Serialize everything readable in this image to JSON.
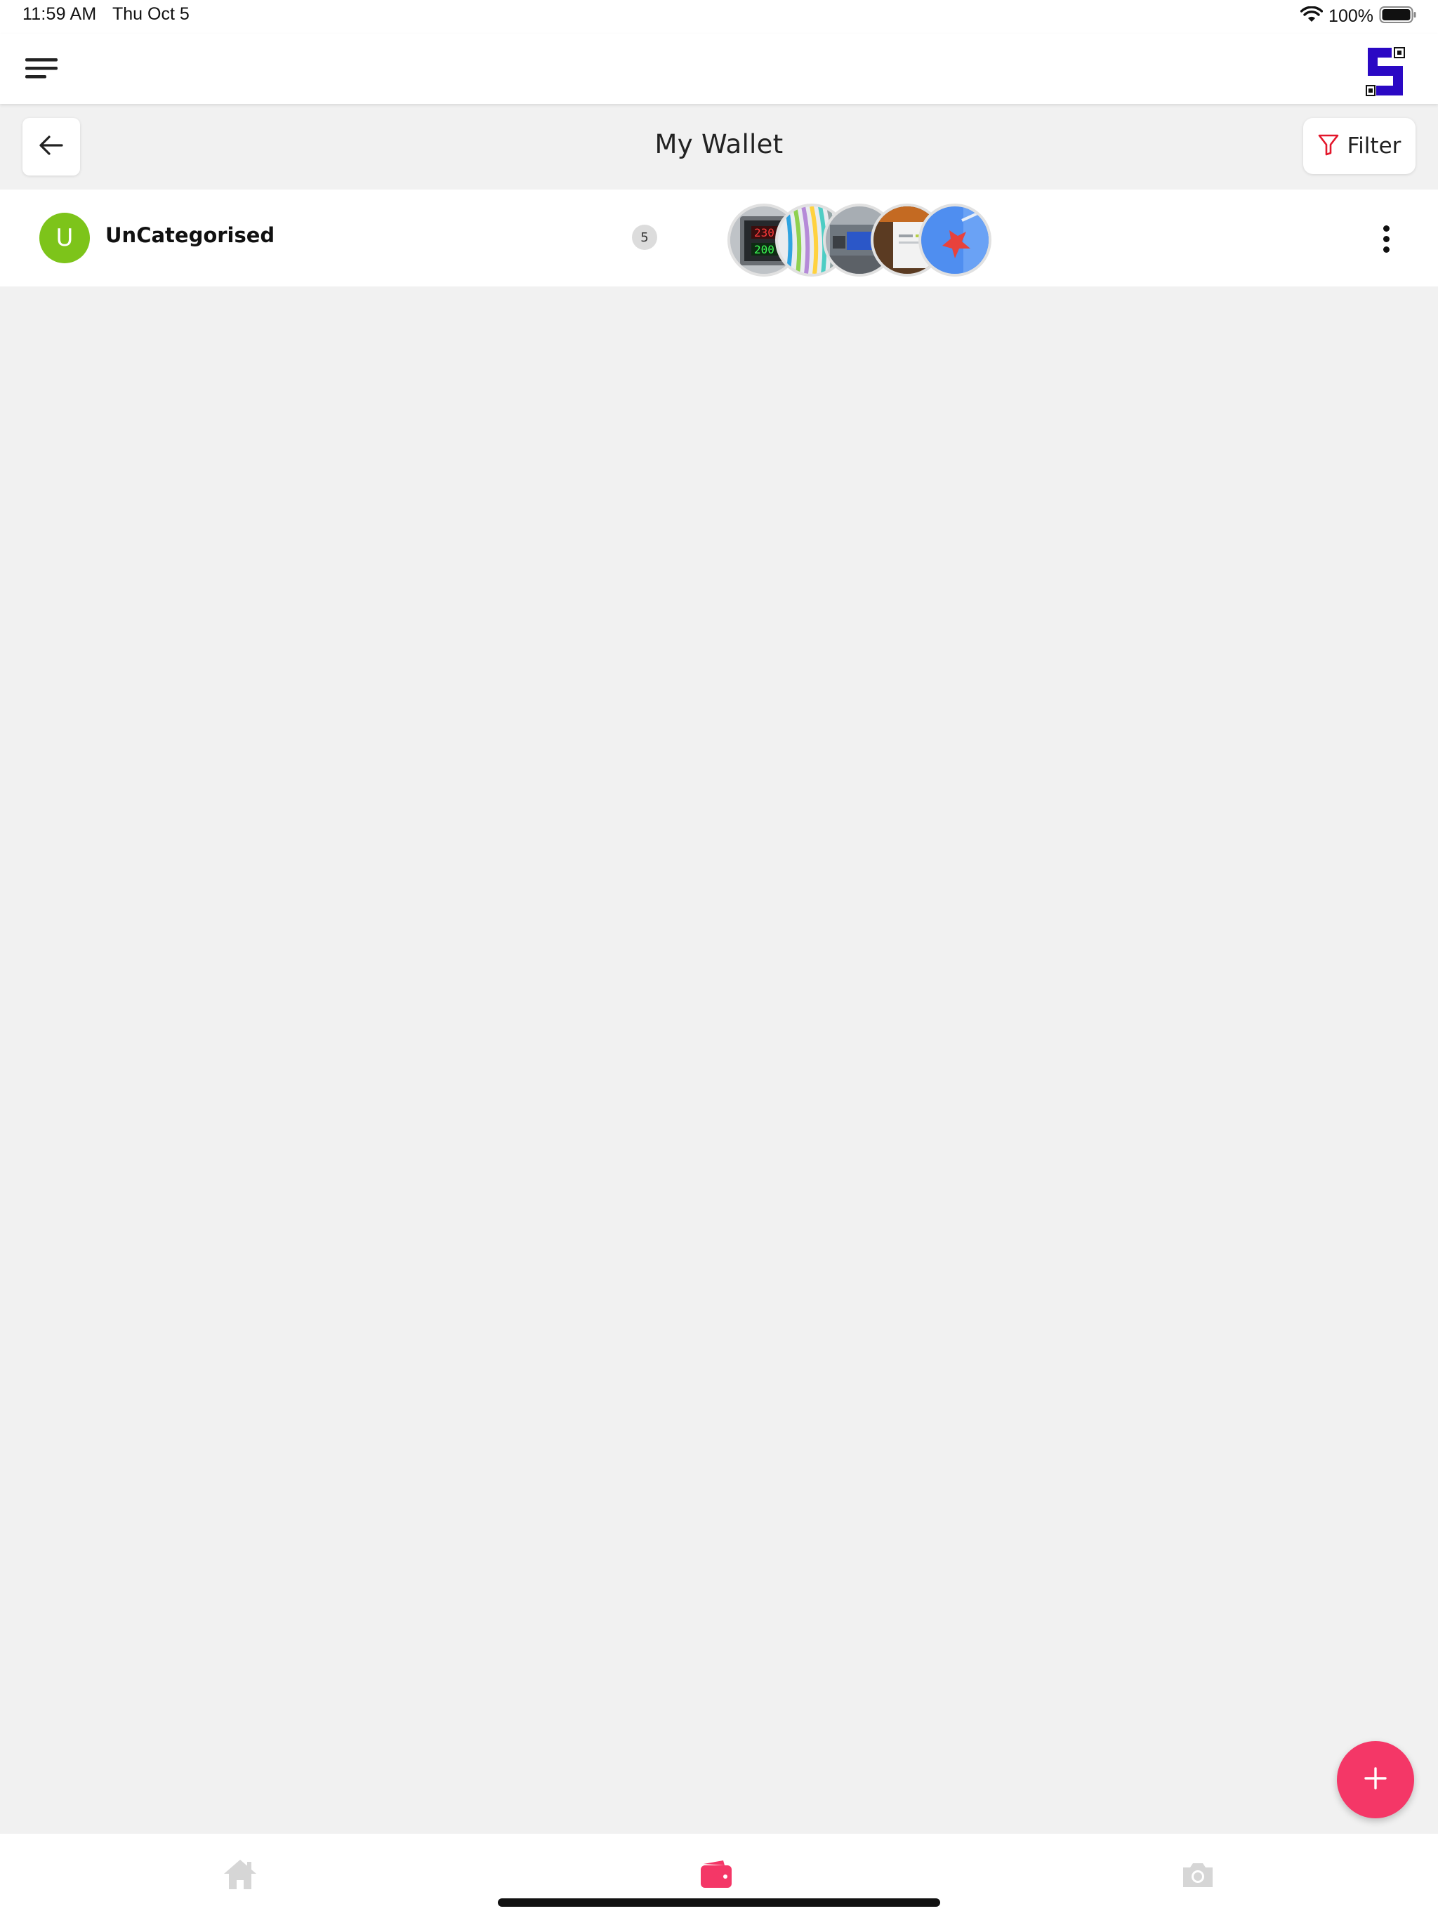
{
  "status_bar": {
    "time": "11:59 AM",
    "date": "Thu Oct 5",
    "battery_percent": "100%",
    "wifi_icon": "wifi-icon",
    "battery_icon": "battery-icon"
  },
  "header": {
    "menu_icon": "hamburger-menu-icon",
    "logo_icon": "app-logo"
  },
  "title_bar": {
    "back_icon": "arrow-left-icon",
    "title": "My Wallet",
    "filter_label": "Filter",
    "filter_icon": "filter-funnel-icon"
  },
  "categories": [
    {
      "avatar_letter": "U",
      "avatar_color": "#7dc41a",
      "name": "UnCategorised",
      "count": "5",
      "thumbnail_count": 5,
      "more_icon": "more-vertical-icon"
    }
  ],
  "fab": {
    "icon": "plus-icon",
    "color": "#f43767"
  },
  "bottom_nav": {
    "items": [
      {
        "icon": "home-icon",
        "active": false
      },
      {
        "icon": "wallet-icon",
        "active": true
      },
      {
        "icon": "camera-icon",
        "active": false
      }
    ],
    "active_color": "#f43767",
    "inactive_color": "#d6d6d6"
  }
}
